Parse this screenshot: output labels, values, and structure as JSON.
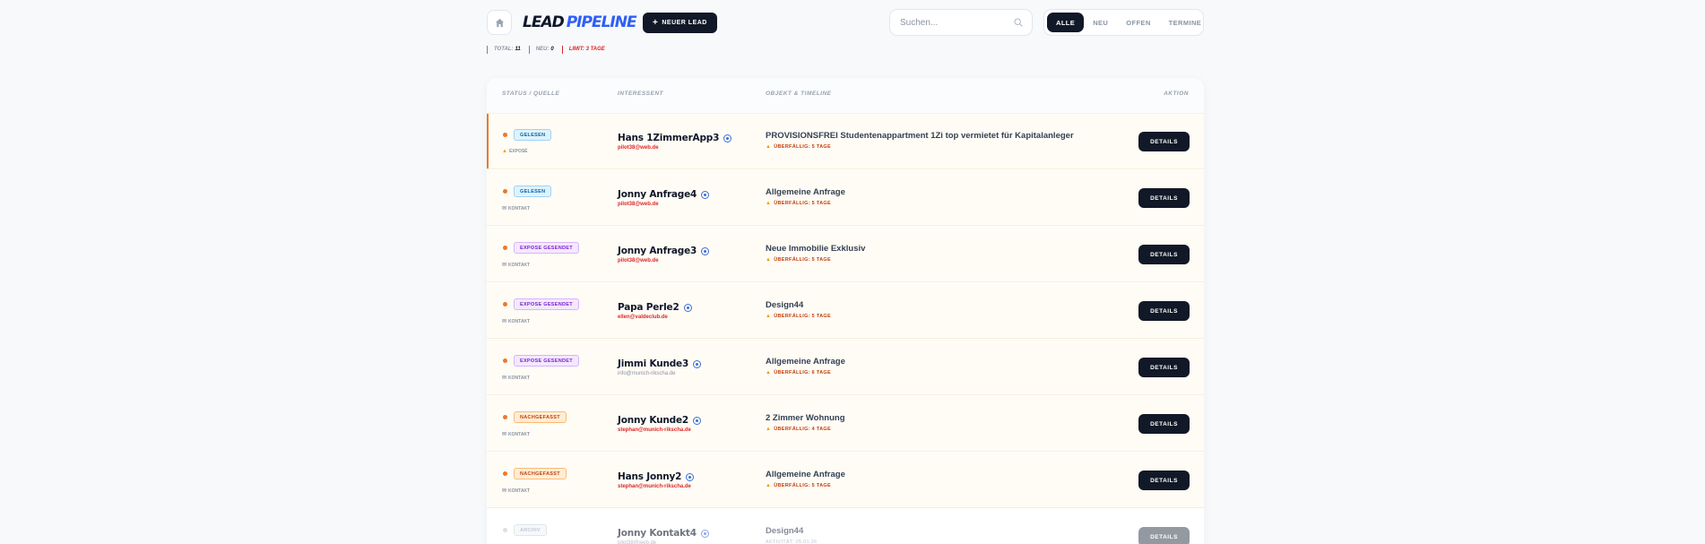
{
  "header": {
    "logo_part1": "LEAD",
    "logo_part2": "PIPELINE",
    "new_lead_label": "NEUER LEAD",
    "search_placeholder": "Suchen...",
    "filters": [
      "ALLE",
      "NEU",
      "OFFEN",
      "TERMINE"
    ],
    "active_filter": "ALLE"
  },
  "stats": {
    "total_label": "TOTAL:",
    "total_value": "11",
    "neu_label": "NEU:",
    "neu_value": "0",
    "limit_text": "LIMIT: 3 TAGE"
  },
  "table": {
    "columns": [
      "STATUS / QUELLE",
      "INTERESSENT",
      "OBJEKT & TIMELINE",
      "AKTION"
    ],
    "action_label": "DETAILS",
    "rows": [
      {
        "status": "GELESEN",
        "source": "EXPOSÉ",
        "name": "Hans 1ZimmerApp3",
        "email": "pilot38@web.de",
        "object": "PROVISIONSFREI Studentenappartment 1Zi top vermietet für Kapitalanleger",
        "due": "ÜBERFÄLLIG: 5 TAGE"
      },
      {
        "status": "GELESEN",
        "source": "KONTAKT",
        "name": "Jonny Anfrage4",
        "email": "pilot38@web.de",
        "object": "Allgemeine Anfrage",
        "due": "ÜBERFÄLLIG: 5 TAGE"
      },
      {
        "status": "EXPOSE GESENDET",
        "source": "KONTAKT",
        "name": "Jonny Anfrage3",
        "email": "pilot38@web.de",
        "object": "Neue Immobilie Exklusiv",
        "due": "ÜBERFÄLLIG: 5 TAGE"
      },
      {
        "status": "EXPOSE GESENDET",
        "source": "KONTAKT",
        "name": "Papa Perle2",
        "email": "ellen@valdeclub.de",
        "object": "Design44",
        "due": "ÜBERFÄLLIG: 5 TAGE"
      },
      {
        "status": "EXPOSE GESENDET",
        "source": "KONTAKT",
        "name": "Jimmi Kunde3",
        "email": "info@munich-rikscha.de",
        "object": "Allgemeine Anfrage",
        "due": "ÜBERFÄLLIG: 6 TAGE"
      },
      {
        "status": "NACHGEFASST",
        "source": "KONTAKT",
        "name": "Jonny Kunde2",
        "email": "stephan@munich-rikscha.de",
        "object": "2 Zimmer Wohnung",
        "due": "ÜBERFÄLLIG: 4 TAGE"
      },
      {
        "status": "NACHGEFASST",
        "source": "KONTAKT",
        "name": "Hans Jonny2",
        "email": "stephan@munich-rikscha.de",
        "object": "Allgemeine Anfrage",
        "due": "ÜBERFÄLLIG: 5 TAGE"
      },
      {
        "status": "ARCHIV",
        "source": "KONTAKT",
        "name": "Jonny Kontakt4",
        "email": "pilot38@web.de",
        "object": "Design44",
        "due": "AKTIVITÄT: 05.01.26"
      }
    ]
  },
  "colors": {
    "accent_blue": "#2f5ff5",
    "dark": "#111827",
    "overdue_orange": "#ea7a2a",
    "email_red": "#dc2626"
  }
}
